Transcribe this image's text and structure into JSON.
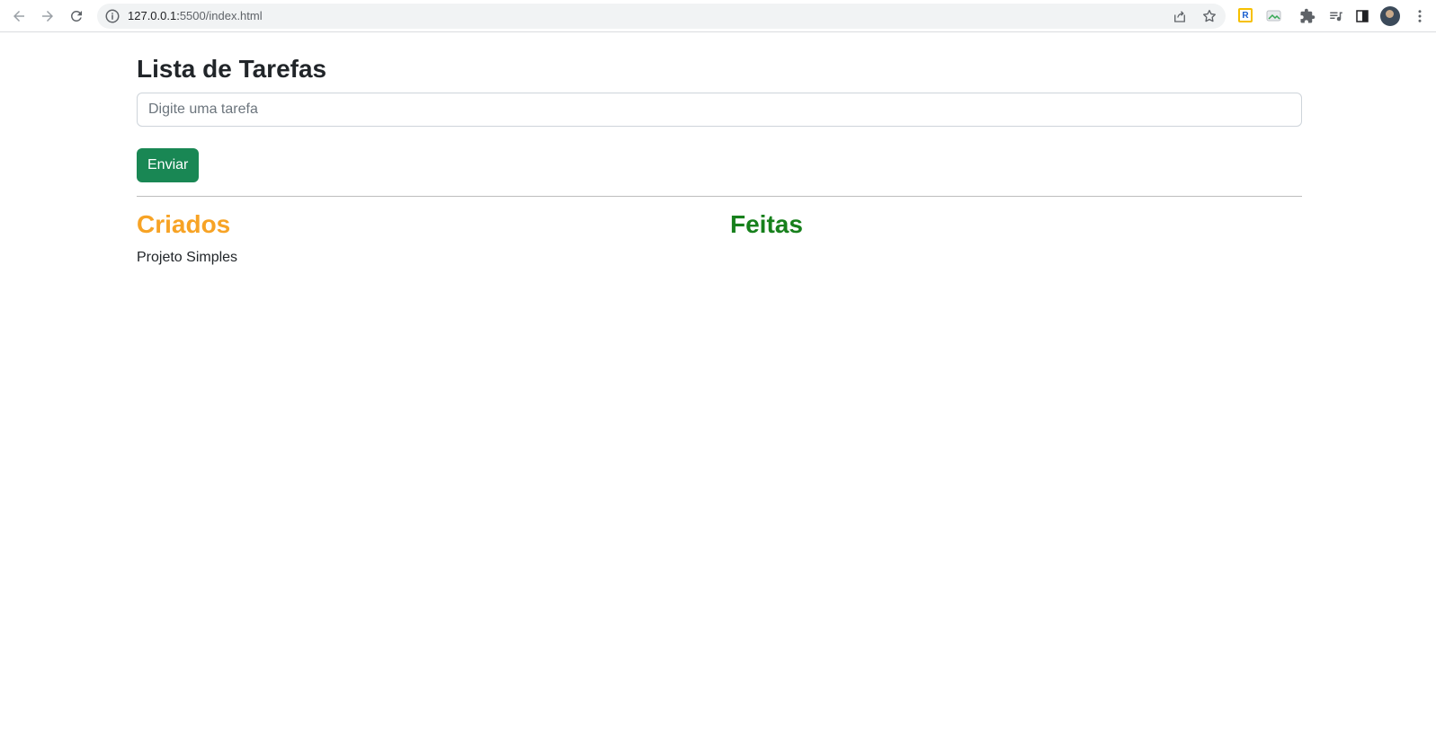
{
  "browser": {
    "url_host": "127.0.0.1:",
    "url_rest": "5500/index.html",
    "ext_r_label": "R"
  },
  "app": {
    "title": "Lista de Tarefas",
    "input_placeholder": "Digite uma tarefa",
    "input_value": "",
    "send_label": "Enviar"
  },
  "columns": {
    "created": {
      "title": "Criados",
      "color": "#f7a325",
      "items": [
        {
          "label": "Projeto Simples"
        }
      ]
    },
    "done": {
      "title": "Feitas",
      "color": "#17801c",
      "items": []
    }
  },
  "colors": {
    "button_bg": "#198754",
    "text": "#212529"
  }
}
